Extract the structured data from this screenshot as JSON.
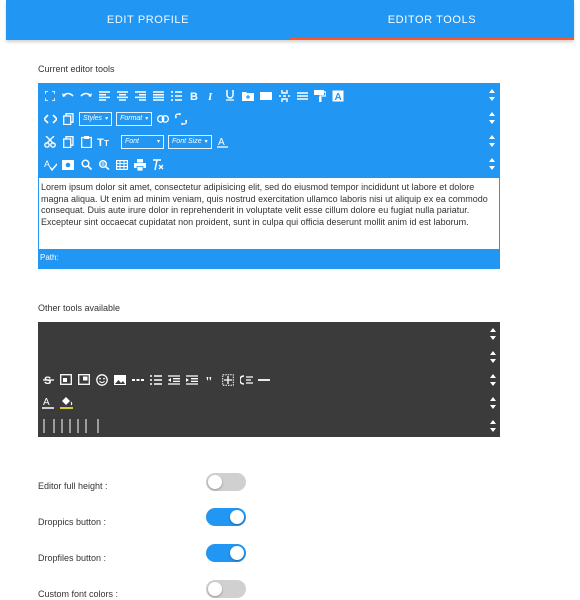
{
  "tabs": [
    {
      "label": "EDIT PROFILE",
      "active": false
    },
    {
      "label": "EDITOR TOOLS",
      "active": true
    }
  ],
  "current_tools": {
    "label": "Current editor tools",
    "selects": {
      "styles": "Styles",
      "format": "Format",
      "font": "Font",
      "font_size": "Font Size"
    },
    "sample_text": "Lorem ipsum dolor sit amet, consectetur adipisicing elit, sed do eiusmod tempor incididunt ut labore et dolore magna aliqua. Ut enim ad minim veniam, quis nostrud exercitation ullamco laboris nisi ut aliquip ex ea commodo consequat. Duis aute irure dolor in reprehenderit in voluptate velit esse cillum dolore eu fugiat nulla pariatur. Excepteur sint occaecat cupidatat non proident, sunt in culpa qui officia deserunt mollit anim id est laborum.",
    "path_label": "Path:"
  },
  "other_tools": {
    "label": "Other tools available"
  },
  "settings": [
    {
      "label": "Editor full height :",
      "on": false
    },
    {
      "label": "Droppics button :",
      "on": true
    },
    {
      "label": "Dropfiles button :",
      "on": true
    },
    {
      "label": "Custom font colors :",
      "on": false
    }
  ],
  "colors": {
    "accent": "#2196f3",
    "tab_indicator": "#ff5722",
    "dark_panel": "#3b3b3b",
    "toggle_off": "#d0d0d0"
  }
}
